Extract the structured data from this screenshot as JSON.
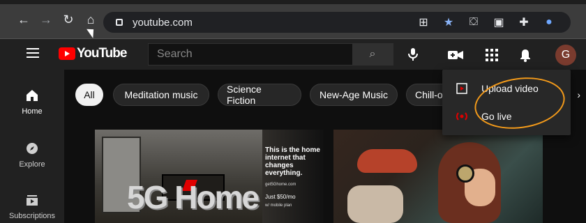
{
  "browser": {
    "url": "youtube.com"
  },
  "youtube": {
    "logo_text": "YouTube",
    "search_placeholder": "Search",
    "avatar_letter": "G"
  },
  "sidebar": {
    "items": [
      {
        "label": "Home"
      },
      {
        "label": "Explore"
      },
      {
        "label": "Subscriptions"
      }
    ]
  },
  "chips": [
    {
      "label": "All"
    },
    {
      "label": "Meditation music"
    },
    {
      "label": "Science Fiction"
    },
    {
      "label": "New-Age Music"
    },
    {
      "label": "Chill-o"
    }
  ],
  "create_menu": {
    "items": [
      {
        "label": "Upload video"
      },
      {
        "label": "Go live"
      }
    ]
  },
  "thumbnails": {
    "ad_title": "This is the home internet that changes everything.",
    "ad_url": "get5Ghome.com",
    "ad_price": "Just $50/mo",
    "ad_small": "w/ mobile plan",
    "ad_big": "5G Home"
  }
}
